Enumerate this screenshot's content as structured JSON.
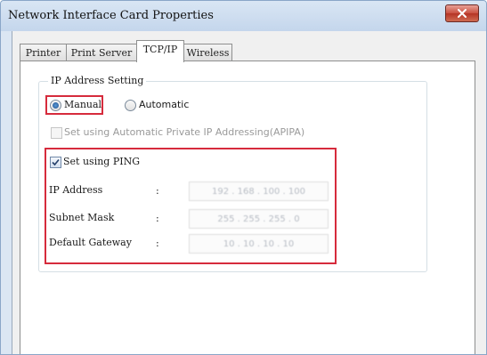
{
  "window": {
    "title": "Network Interface Card Properties"
  },
  "tabs": [
    {
      "label": "Printer",
      "active": false
    },
    {
      "label": "Print Server",
      "active": false
    },
    {
      "label": "TCP/IP",
      "active": true
    },
    {
      "label": "Wireless",
      "active": false
    }
  ],
  "ip_address_setting": {
    "legend": "IP Address Setting",
    "manual_label": "Manual",
    "automatic_label": "Automatic",
    "selected": "Manual",
    "apipa_label": "Set using Automatic Private IP Addressing(APIPA)",
    "apipa_checked": false,
    "apipa_enabled": false
  },
  "ping": {
    "label": "Set using PING",
    "checked": true
  },
  "fields": [
    {
      "label": "IP Address",
      "separator": ":",
      "value": "192 . 168 . 100 . 100"
    },
    {
      "label": "Subnet Mask",
      "separator": ":",
      "value": "255 . 255 . 255 . 0"
    },
    {
      "label": "Default Gateway",
      "separator": ":",
      "value": "10 . 10 . 10 . 10"
    }
  ],
  "colors": {
    "highlight_border": "#d62b3c",
    "title_bar": "#c4d6ec",
    "close_button": "#c8503f"
  },
  "icons": {
    "close": "close-x-icon",
    "check": "checkmark-icon"
  }
}
